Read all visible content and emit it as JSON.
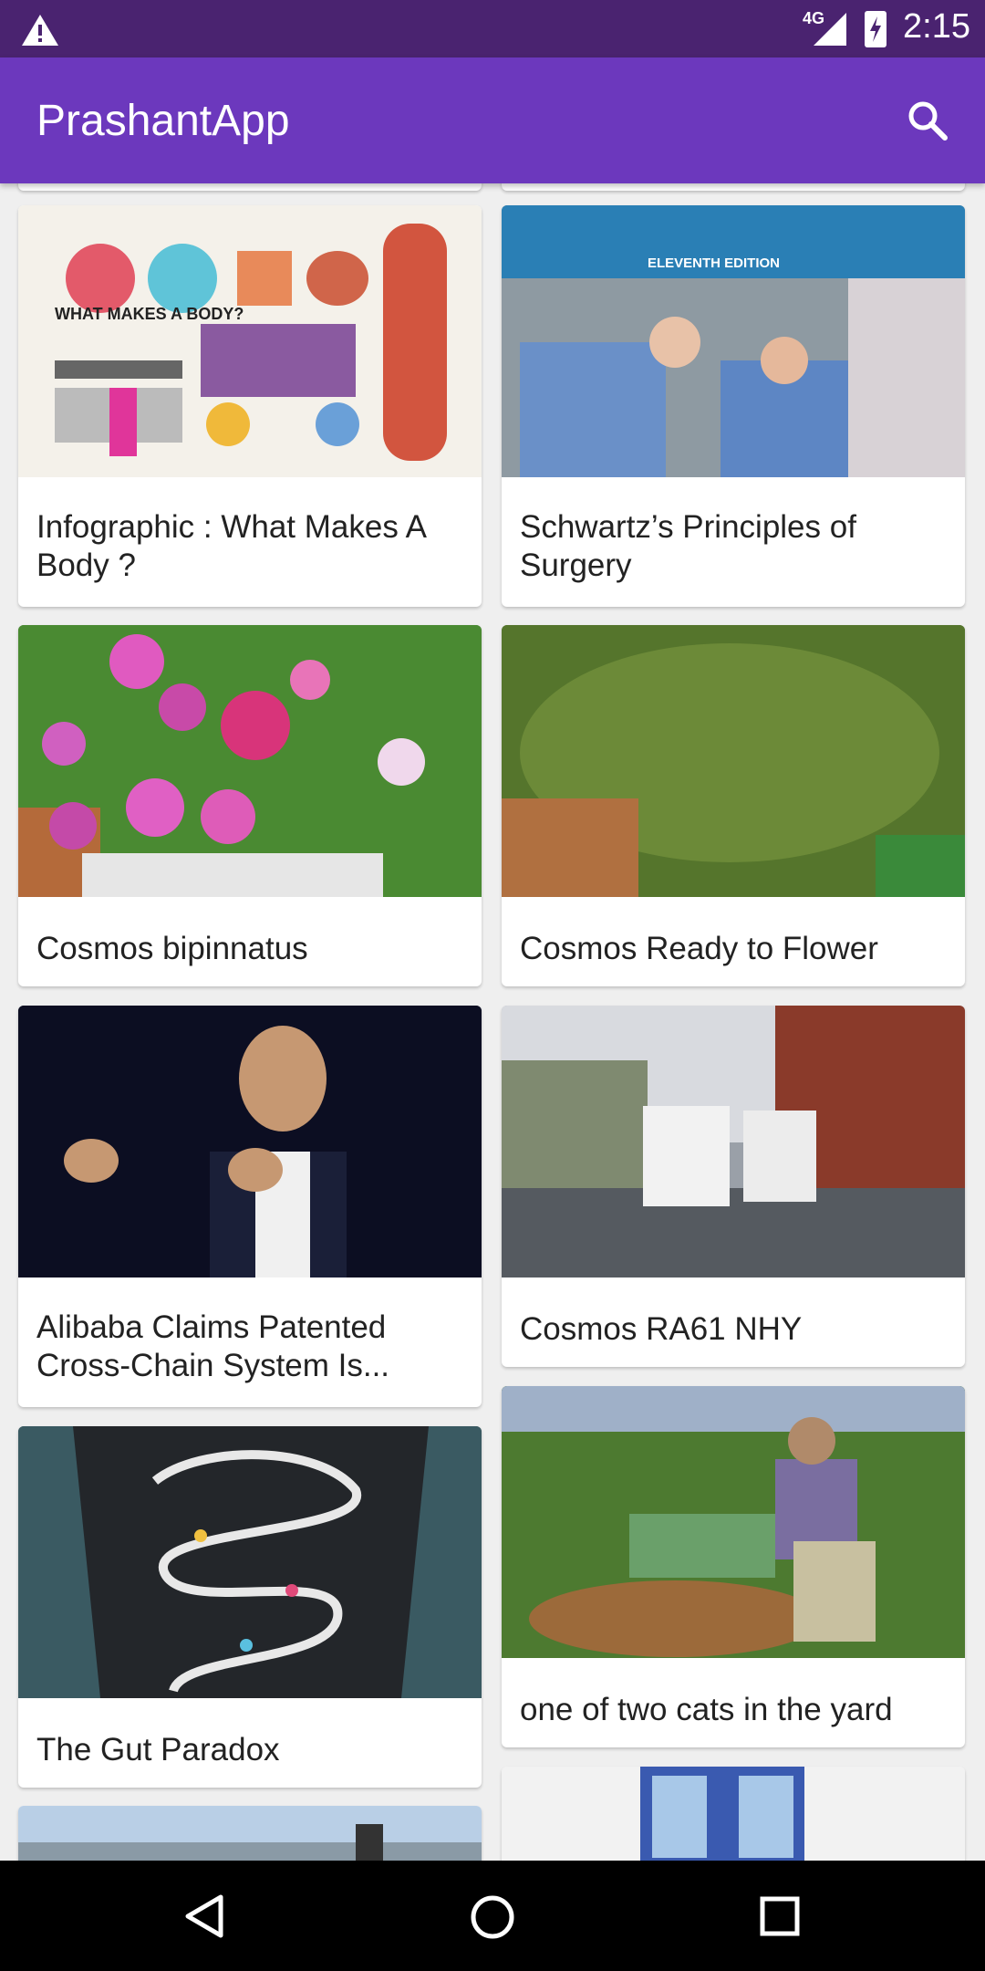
{
  "status_bar": {
    "time": "2:15",
    "network": "4G",
    "icons": [
      "warning-icon",
      "signal-icon",
      "battery-charging-icon"
    ]
  },
  "app_bar": {
    "title": "PrashantApp",
    "search_icon": "search-icon"
  },
  "cards": [
    {
      "title": "Infographic : What Makes A Body ?",
      "image_text": "WHAT MAKES A BODY?"
    },
    {
      "title": "Schwartz’s Principles of Surgery",
      "image_text": "ELEVENTH EDITION"
    },
    {
      "title": "Cosmos bipinnatus"
    },
    {
      "title": "Cosmos Ready to Flower"
    },
    {
      "title": "Alibaba Claims Patented Cross-Chain System Is..."
    },
    {
      "title": "Cosmos RA61 NHY"
    },
    {
      "title": "The Gut Paradox"
    },
    {
      "title": "one of two cats in the yard"
    }
  ],
  "nav_bar": {
    "icons": [
      "back-icon",
      "home-icon",
      "recents-icon"
    ]
  }
}
